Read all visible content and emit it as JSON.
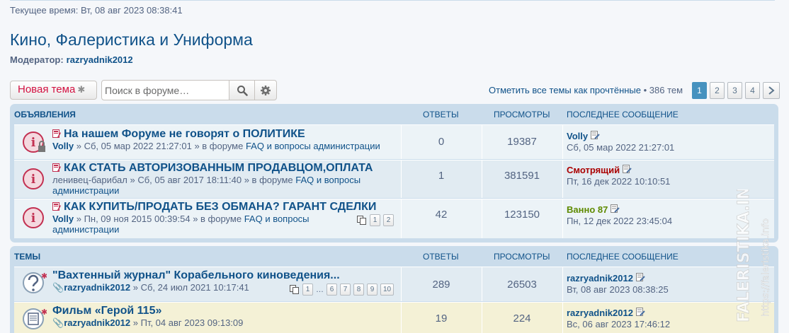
{
  "header": {
    "current_time": "Текущее время: Вт, 08 авг 2023 08:38:41",
    "forum_title": "Кино, Фалеристика и Униформа",
    "moderator_label": "Модератор:",
    "moderator_name": "razryadnik2012"
  },
  "toolbar": {
    "new_topic_label": "Новая тема",
    "search_placeholder": "Поиск в форуме…",
    "mark_read_label": "Отметить все темы как прочтённые",
    "topics_count": "• 386 тем",
    "pages": [
      "1",
      "2",
      "3",
      "4"
    ],
    "active_page": "1"
  },
  "announcements": {
    "header": "ОБЪЯВЛЕНИЯ",
    "col_replies": "ОТВЕТЫ",
    "col_views": "ПРОСМОТРЫ",
    "col_last": "ПОСЛЕДНЕЕ СООБЩЕНИЕ",
    "rows": [
      {
        "title": "На нашем Форуме не говорят о ПОЛИТИКЕ",
        "author": "Volly",
        "date_sep": " » Сб, 05 мар 2022 21:27:01 » в форуме ",
        "forum": "FAQ и вопросы администрации",
        "replies": "0",
        "views": "19387",
        "last_user": "Volly",
        "last_user_color": "#105289",
        "last_date": "Сб, 05 мар 2022 21:27:01"
      },
      {
        "title": "КАК СТАТЬ АВТОРИЗОВАННЫМ ПРОДАВЦОМ,ОПЛАТА",
        "author": "ленивец-барибал",
        "date_sep": " » Сб, 05 авг 2017 18:11:40 » в форуме ",
        "forum": "FAQ и вопросы администрации",
        "replies": "1",
        "views": "381591",
        "last_user": "Смотрящий",
        "last_user_color": "#aa0000",
        "last_date": "Пт, 16 дек 2022 10:10:51"
      },
      {
        "title": "КАК КУПИТЬ/ПРОДАТЬ БЕЗ ОБМАНА? ГАРАНТ СДЕЛКИ",
        "author": "Volly",
        "date_sep": " » Пн, 09 ноя 2015 00:39:54 » в форуме ",
        "forum": "FAQ и вопросы администрации",
        "pages": [
          "1",
          "2"
        ],
        "replies": "42",
        "views": "123150",
        "last_user": "Ванно 87",
        "last_user_color": "#5e8a00",
        "last_date": "Пн, 12 дек 2022 23:45:04"
      }
    ]
  },
  "topics": {
    "header": "ТЕМЫ",
    "col_replies": "ОТВЕТЫ",
    "col_views": "ПРОСМОТРЫ",
    "col_last": "ПОСЛЕДНЕЕ СООБЩЕНИЕ",
    "rows": [
      {
        "title": "\"Вахтенный журнал\" Корабельного киноведения...",
        "author": "razryadnik2012",
        "date_sep": " » Сб, 24 июл 2021 10:17:41",
        "pages": [
          "1",
          "…",
          "6",
          "7",
          "8",
          "9",
          "10"
        ],
        "replies": "289",
        "views": "26503",
        "last_user": "razryadnik2012",
        "last_date": "Вт, 08 авг 2023 08:38:25"
      },
      {
        "title": "Фильм «Герой 115»",
        "author": "razryadnik2012",
        "date_sep": " » Пт, 04 авг 2023 09:13:09",
        "replies": "19",
        "views": "224",
        "last_user": "razryadnik2012",
        "last_date": "Вс, 06 авг 2023 17:46:12"
      }
    ]
  },
  "watermark": "FALERISTIKA.INFO",
  "watermark_url": "https://faleristika.info"
}
